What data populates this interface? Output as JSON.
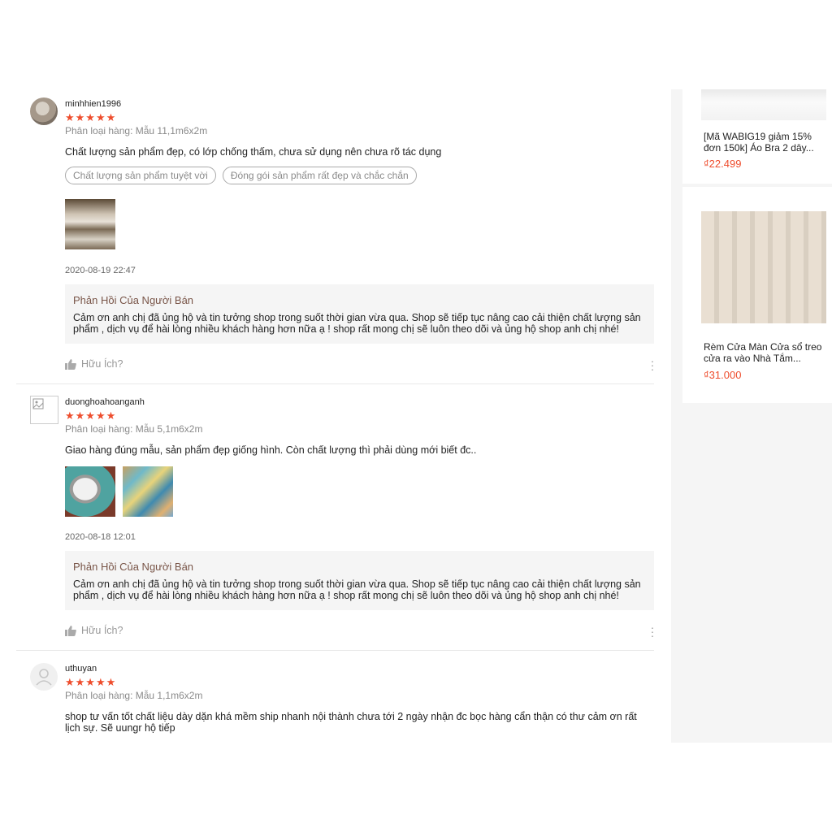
{
  "reviews": [
    {
      "username": "minhhien1996",
      "stars": "★★★★★",
      "variation": "Phân loại hàng: Mẫu 11,1m6x2m",
      "comment": "Chất lượng sản phẩm đẹp, có lớp chống thấm, chưa sử dụng nên chưa rõ tác dụng",
      "tags": [
        "Chất lượng sản phẩm tuyệt vời",
        "Đóng gói sản phẩm rất đẹp và chắc chắn"
      ],
      "date": "2020-08-19 22:47",
      "reply_title": "Phản Hồi Của Người Bán",
      "reply_text": "Cảm ơn anh chị đã ủng hộ và tin tưởng shop trong suốt thời gian vừa qua. Shop sẽ tiếp tục nâng cao cải thiện chất lượng sản phẩm , dịch vụ để hài lòng nhiều khách hàng hơn nữa ạ ! shop  rất mong chị sẽ luôn theo dõi và ủng hộ shop anh chị nhé!",
      "helpful": "Hữu Ích?"
    },
    {
      "username": "duonghoahoanganh",
      "stars": "★★★★★",
      "variation": "Phân loại hàng: Mẫu 5,1m6x2m",
      "comment": "Giao hàng đúng mẫu, sản phẩm đẹp giống hình. Còn chất lượng thì phải dùng mới biết đc..",
      "date": "2020-08-18 12:01",
      "reply_title": "Phản Hồi Của Người Bán",
      "reply_text": "Cảm ơn anh chị đã ủng hộ và tin tưởng shop trong suốt thời gian vừa qua. Shop sẽ tiếp tục nâng cao cải thiện chất lượng sản phẩm , dịch vụ để hài lòng nhiều khách hàng hơn nữa ạ ! shop  rất mong chị sẽ luôn theo dõi và ủng hộ shop anh chị nhé!",
      "helpful": "Hữu Ích?"
    },
    {
      "username": "uthuyan",
      "stars": "★★★★★",
      "variation": "Phân loại hàng: Mẫu 1,1m6x2m",
      "comment": "shop tư vấn tốt chất liệu dày dặn khá mềm ship nhanh nội thành chưa tới 2 ngày nhận đc bọc hàng cẩn thận có thư cảm ơn rất lịch sự. Sẽ uungr hộ tiếp"
    }
  ],
  "sidebar": {
    "items": [
      {
        "title": "[Mã WABIG19 giảm 15% đơn 150k] Áo Bra 2 dây...",
        "price": "₫22.499"
      },
      {
        "title": "Rèm Cửa Màn Cửa sổ treo cửa ra vào Nhà Tắm...",
        "price": "₫31.000"
      }
    ]
  },
  "colors": {
    "star": "#ee4d2d",
    "price": "#ee4d2d",
    "reply_title": "#795548",
    "reply_bg": "#f5f5f5"
  }
}
